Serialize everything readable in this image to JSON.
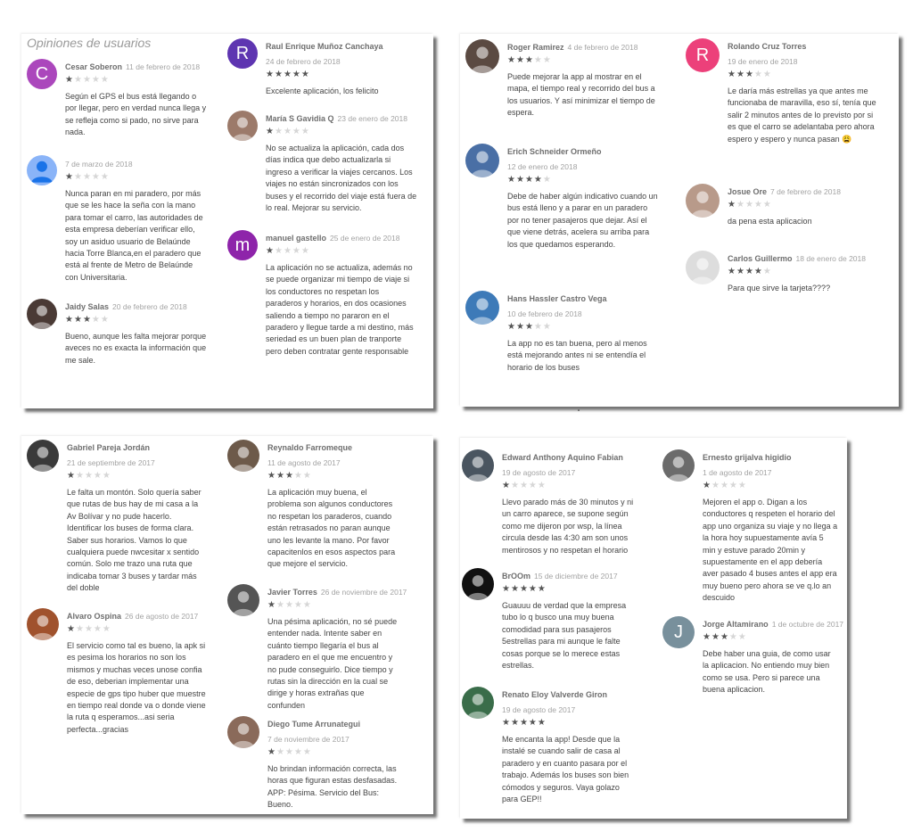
{
  "title": "Opiniones de usuarios",
  "colors": {
    "star_on": "#555555",
    "star_off": "#d6d6d6",
    "name": "#6e6e6e",
    "date": "#a3a3a3"
  },
  "reviews": [
    {
      "name": "Cesar Soberon",
      "date": "11 de febrero de 2018",
      "rating": 1,
      "avatar_letter": "C",
      "avatar_color": "#ab47bc",
      "text": "Según el GPS el bus está llegando o por llegar, pero en verdad nunca llega y se refleja como si pado, no sirve para nada."
    },
    {
      "name": "",
      "date": "7 de marzo de 2018",
      "rating": 1,
      "avatar_letter": "",
      "avatar_color": "#8ab4f8",
      "text": "Nunca paran en mi paradero, por más que se les hace la seña con la mano para tomar el carro, las autoridades de esta empresa deberían verificar ello, soy un asiduo usuario de Belaúnde hacia Torre Blanca,en el paradero que está al frente de Metro de Belaúnde con Universitaria."
    },
    {
      "name": "Jaidy Salas",
      "date": "20 de febrero de 2018",
      "rating": 3,
      "avatar_letter": "",
      "avatar_color": "#4a3a35",
      "text": "Bueno, aunque les falta mejorar porque aveces no es exacta la información que me sale."
    },
    {
      "name": "Raul Enrique Muñoz Canchaya",
      "date": "24 de febrero de 2018",
      "rating": 5,
      "avatar_letter": "R",
      "avatar_color": "#5e35b1",
      "text": "Excelente aplicación, los felicito"
    },
    {
      "name": "María S Gavidia Q",
      "date": "23 de enero de 2018",
      "rating": 1,
      "avatar_letter": "",
      "avatar_color": "#9c7a6a",
      "text": "No se actualiza la aplicación, cada dos días indica que debo actualizarla si ingreso a verificar la viajes cercanos. Los viajes no están sincronizados con los buses y el recorrido del viaje está fuera de lo real. Mejorar su servicio."
    },
    {
      "name": "manuel gastello",
      "date": "25 de enero de 2018",
      "rating": 1,
      "avatar_letter": "m",
      "avatar_color": "#8e24aa",
      "text": "La aplicación no se actualiza, además no se puede organizar mi tiempo de viaje si los conductores no respetan los paraderos y horarios, en dos ocasiones saliendo a tiempo no pararon en el paradero y llegue tarde a mi destino, más seriedad es un buen plan de tranporte pero deben contratar gente responsable"
    },
    {
      "name": "Roger Ramirez",
      "date": "4 de febrero de 2018",
      "rating": 3,
      "avatar_letter": "",
      "avatar_color": "#5b4a42",
      "text": "Puede mejorar la app al mostrar en el mapa, el tiempo real y recorrido del bus a los usuarios. Y así minimizar el tiempo de espera."
    },
    {
      "name": "Erich Schneider Ormeño",
      "date": "12 de enero de 2018",
      "rating": 4,
      "avatar_letter": "",
      "avatar_color": "#4a6fa5",
      "text": "Debe de haber algún indicativo cuando un bus está lleno y a parar en un paradero por no tener pasajeros que dejar. Así el que viene detrás, acelera su arriba para los que quedamos esperando."
    },
    {
      "name": "Hans Hassler Castro Vega",
      "date": "10 de febrero de 2018",
      "rating": 3,
      "avatar_letter": "",
      "avatar_color": "#3d7ab8",
      "text": "La app no es tan buena, pero al menos está mejorando antes ni se entendía el horario de los buses"
    },
    {
      "name": "Rolando Cruz Torres",
      "date": "19 de enero de 2018",
      "rating": 3,
      "avatar_letter": "R",
      "avatar_color": "#ec407a",
      "text": "Le daría más estrellas ya que antes me funcionaba de maravilla, eso sí, tenía que salir 2 minutos antes de lo previsto por si es que el carro se adelantaba pero ahora espero y espero y nunca pasan 😩"
    },
    {
      "name": "Josue Ore",
      "date": "7 de febrero de 2018",
      "rating": 1,
      "avatar_letter": "",
      "avatar_color": "#b89a8a",
      "text": "da pena esta aplicacion"
    },
    {
      "name": "Carlos Guillermo",
      "date": "18 de enero de 2018",
      "rating": 4,
      "avatar_letter": "",
      "avatar_color": "#dddddd",
      "text": "Para que sirve la tarjeta????"
    },
    {
      "name": "Gabriel Pareja Jordán",
      "date": "21 de septiembre de 2017",
      "rating": 1,
      "avatar_letter": "",
      "avatar_color": "#3a3a3a",
      "text": "Le falta un montón. Solo quería saber que rutas de bus hay de mi casa a la Av Bolívar y no pude hacerlo. Identificar los buses de forma clara. Saber sus horarios. Vamos lo que cualquiera puede nwcesitar x sentido común. Solo me trazo una ruta que indicaba tomar 3 buses y tardar más del doble"
    },
    {
      "name": "Alvaro Ospina",
      "date": "26 de agosto de 2017",
      "rating": 1,
      "avatar_letter": "",
      "avatar_color": "#a0522d",
      "text": "El servicio como tal es bueno, la apk si es pesima los horarios no son los mismos y muchas veces unose confia de eso, deberian implementar una especie de gps tipo huber que muestre en tiempo real donde va o donde viene la ruta q esperamos...asi seria perfecta...gracias"
    },
    {
      "name": "Reynaldo Farromeque",
      "date": "11 de agosto de 2017",
      "rating": 3,
      "avatar_letter": "",
      "avatar_color": "#6d5a4a",
      "text": "La aplicación muy buena, el problema son algunos conductores no respetan los paraderos, cuando están retrasados no paran aunque uno les levante la mano. Por favor capacitenlos en esos aspectos para que mejore el servicio."
    },
    {
      "name": "Javier Torres",
      "date": "26 de noviembre de 2017",
      "rating": 1,
      "avatar_letter": "",
      "avatar_color": "#555555",
      "text": "Una pésima aplicación, no sé puede entender nada. Intente saber en cuánto tiempo llegaría el bus al paradero en el que me encuentro y no pude conseguirlo. Dice tiempo y rutas sin la dirección en la cual se dirige y horas extrañas que confunden"
    },
    {
      "name": "Diego Tume Arrunategui",
      "date": "7 de noviembre de 2017",
      "rating": 1,
      "avatar_letter": "",
      "avatar_color": "#8a6a5a",
      "text": "No brindan información correcta, las horas que figuran estas desfasadas. APP: Pésima. Servicio del Bus: Bueno."
    },
    {
      "name": "Edward Anthony Aquino Fabian",
      "date": "19 de agosto de 2017",
      "rating": 1,
      "avatar_letter": "",
      "avatar_color": "#4a5560",
      "text": "Llevo parado más de 30 minutos y ni un carro aparece, se supone según como me dijeron por wsp, la línea circula desde las 4:30 am son unos mentirosos y no respetan el horario"
    },
    {
      "name": "BrOOm",
      "date": "15 de diciembre de 2017",
      "rating": 5,
      "avatar_letter": "",
      "avatar_color": "#111111",
      "text": "Guauuu de verdad que la empresa tubo lo q busco una muy buena comodidad para sus pasajeros 5estrellas para mi aunque le falte cosas porque se lo merece estas estrellas."
    },
    {
      "name": "Renato Eloy Valverde Giron",
      "date": "19 de agosto de 2017",
      "rating": 5,
      "avatar_letter": "",
      "avatar_color": "#3a6d4a",
      "text": "Me encanta la app! Desde que la instalé se cuando salir de casa al paradero y en cuanto pasara por el trabajo. Además los buses son bien cómodos y seguros. Vaya golazo para GEP!!"
    },
    {
      "name": "Ernesto grijalva higidio",
      "date": "1 de agosto de 2017",
      "rating": 1,
      "avatar_letter": "",
      "avatar_color": "#6b6b6b",
      "text": "Mejoren el app o. Digan a los conductores q respeten el horario del app uno organiza su viaje y no llega a la hora hoy supuestamente avía 5 min y estuve parado 20min y supuestamente en el app debería aver pasado 4 buses antes el app era muy bueno pero ahora se ve q.lo an descuido"
    },
    {
      "name": "Jorge Altamirano",
      "date": "1 de octubre de 2017",
      "rating": 3,
      "avatar_letter": "J",
      "avatar_color": "#78909c",
      "text": "Debe haber una guia, de como usar la aplicacion. No entiendo muy bien como se usa. Pero si parece una buena aplicacion."
    }
  ]
}
